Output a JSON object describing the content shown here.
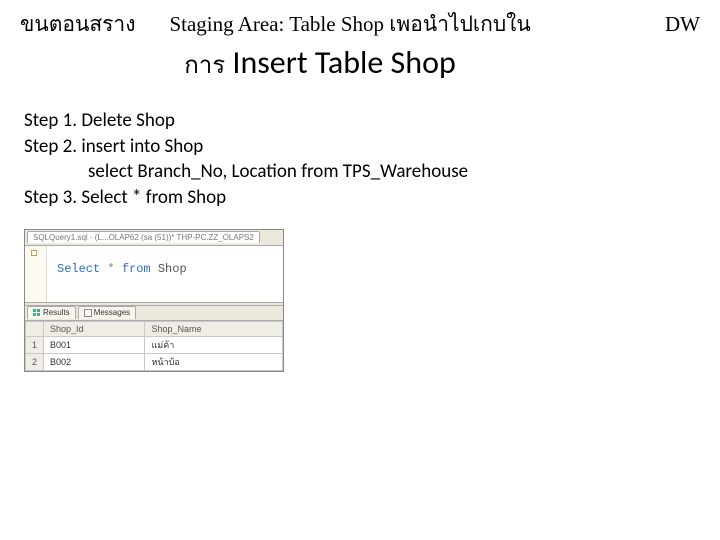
{
  "header": {
    "left": "ขนตอนสราง",
    "center": "Staging Area: Table Shop เพอนำไปเกบใน",
    "right": "DW"
  },
  "subtitle": {
    "thai": "การ",
    "main": "Insert Table Shop"
  },
  "steps": {
    "s1": "Step 1. Delete Shop",
    "s2": "Step 2. insert into Shop",
    "s2b": "select Branch_No, Location from TPS_Warehouse",
    "s3": "Step 3. Select * from Shop"
  },
  "ide": {
    "tab": "SQLQuery1.sql - (L...OLAP62 (sa (51))* THP-PC.ZZ_OLAPS2",
    "code": {
      "kw1": "Select",
      "star": "*",
      "kw2": "from",
      "tbl": "Shop"
    },
    "resultTabs": {
      "results": "Results",
      "messages": "Messages"
    },
    "cols": {
      "c1": "Shop_Id",
      "c2": "Shop_Name"
    },
    "rows": [
      {
        "n": "1",
        "id": "B001",
        "name": "แม่ค้า"
      },
      {
        "n": "2",
        "id": "B002",
        "name": "หน้าบ้อ"
      }
    ]
  }
}
